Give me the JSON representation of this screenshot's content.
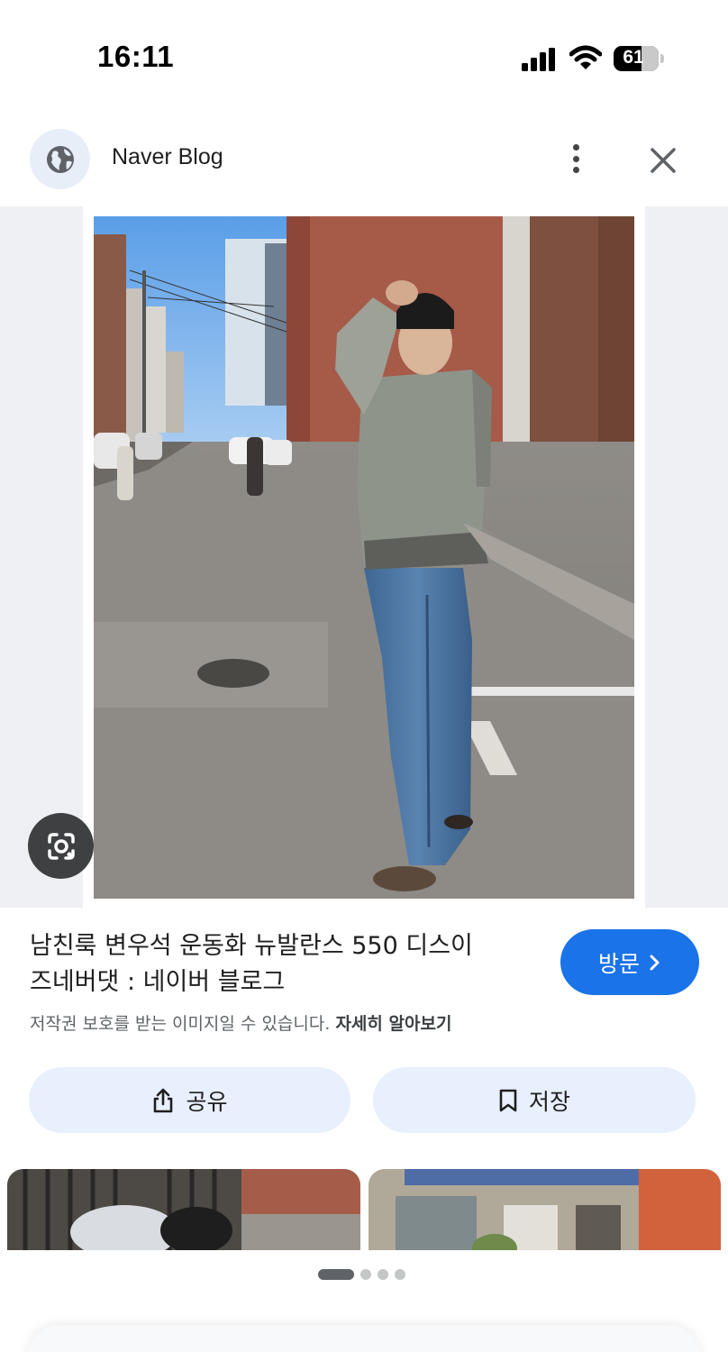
{
  "status_bar": {
    "time": "16:11",
    "battery_percent": "61",
    "icons": [
      "cellular-signal-icon",
      "wifi-icon",
      "battery-icon"
    ]
  },
  "header": {
    "site_name": "Naver Blog",
    "site_icon": "globe-icon",
    "more_icon": "more-vert-icon",
    "close_icon": "close-icon"
  },
  "image": {
    "lens_icon": "google-lens-icon"
  },
  "info": {
    "title_line1": "남친룩 변우석 운동화 뉴발란스 550 디스이",
    "title_line2": "즈네버댓 : 네이버 블로그",
    "visit_label": "방문",
    "copyright_text": "저작권 보호를 받는 이미지일 수 있습니다.",
    "learn_more_label": "자세히 알아보기"
  },
  "actions": {
    "share_label": "공유",
    "save_label": "저장"
  },
  "carousel": {
    "page_count": 4,
    "active_index": 0
  },
  "colors": {
    "accent": "#1a73e8",
    "button_bg": "#e8f0fe",
    "secondary_text": "#5f6368"
  }
}
